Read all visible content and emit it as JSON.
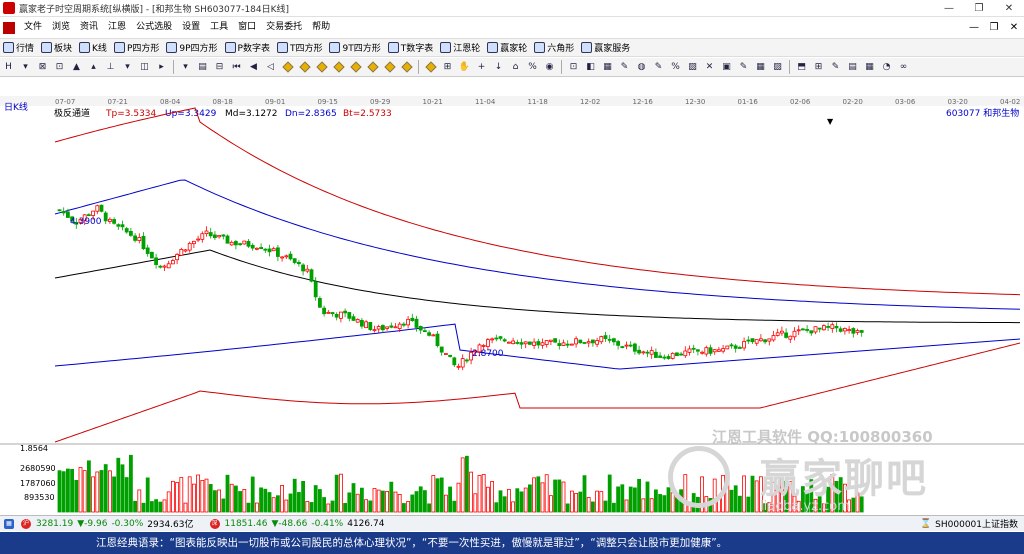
{
  "window": {
    "title": "赢家老子时空周期系统[纵横版] - [和邦生物  SH603077-184日K线]",
    "minimize": "—",
    "restore": "❐",
    "close": "✕"
  },
  "menu": {
    "items": [
      "文件",
      "浏览",
      "资讯",
      "江恩",
      "公式选股",
      "设置",
      "工具",
      "窗口",
      "交易委托",
      "帮助"
    ],
    "right_controls": [
      "—",
      "❐",
      "✕"
    ]
  },
  "toolbar1": {
    "items": [
      {
        "icon": "grid-icon",
        "label": "行情"
      },
      {
        "icon": "blocks-icon",
        "label": "板块"
      },
      {
        "icon": "candle-icon",
        "label": "K线"
      },
      {
        "icon": "p-square-icon",
        "label": "P四方形"
      },
      {
        "icon": "9p-square-icon",
        "label": "9P四方形"
      },
      {
        "icon": "p-table-icon",
        "label": "P数字表"
      },
      {
        "icon": "t-square-icon",
        "label": "T四方形"
      },
      {
        "icon": "9t-square-icon",
        "label": "9T四方形"
      },
      {
        "icon": "t-table-icon",
        "label": "T数字表"
      },
      {
        "icon": "gann-wheel-icon",
        "label": "江恩轮"
      },
      {
        "icon": "winner-wheel-icon",
        "label": "赢家轮"
      },
      {
        "icon": "hexagon-icon",
        "label": "六角形"
      },
      {
        "icon": "dollar-icon",
        "label": "赢家服务"
      }
    ]
  },
  "toolbar2": {
    "glyphs": [
      "H",
      "▾",
      "⊠",
      "⊡",
      "▲",
      "▴",
      "⊥",
      "▾",
      "◫",
      "▸",
      "▾",
      "▤",
      "⊟",
      "⏮",
      "◀",
      "◁",
      "◆",
      "◆",
      "◆",
      "◆",
      "◆",
      "◆",
      "◆",
      "◆",
      "◆",
      "⊞",
      "✋",
      "+",
      "↓",
      "⌂",
      "%",
      "◉",
      "⊡",
      "◧",
      "▦",
      "✎",
      "◍",
      "✎",
      "%",
      "▨",
      "✕",
      "▣",
      "✎",
      "▦",
      "▨",
      "⬒",
      "⊞",
      "✎",
      "▤",
      "▦",
      "◔",
      "∞"
    ]
  },
  "chart": {
    "period_label": "日K线",
    "indicator_name": "极反通道",
    "tp": "Tp=3.5334",
    "up": "Up=3.3429",
    "md": "Md=3.1272",
    "dn": "Dn=2.8365",
    "bt": "Bt=2.5733",
    "stock_label": "603077  和邦生物",
    "high_label": "4.3900",
    "low_label": "2.8700",
    "lower_price_label": "1.8564",
    "volume_ticks": [
      "2680590",
      "1787060",
      "893530"
    ],
    "date_ticks": [
      "07-07",
      "07-21",
      "08-04",
      "08-18",
      "09-01",
      "09-15",
      "09-29",
      "10-21",
      "11-04",
      "11-18",
      "12-02",
      "12-16",
      "12-30",
      "01-16",
      "02-06",
      "02-20",
      "03-06",
      "03-20",
      "04-02"
    ],
    "colors": {
      "up": "#ff0000",
      "down": "#00a000",
      "top": "#cc0000",
      "mid": "#0000cc",
      "md": "#000000"
    }
  },
  "watermark": {
    "line1": "江恩工具软件  QQ:100800360",
    "line2": "赢家聊吧",
    "line3": "liaoba.yz.com"
  },
  "status": {
    "sh_value": "3281.19",
    "sh_change": "▼-9.96",
    "sh_pct": "-0.30%",
    "sh_amount": "2934.63亿",
    "sz_value": "11851.46",
    "sz_change": "▼-48.66",
    "sz_pct": "-0.41%",
    "sz_amount": "4126.74",
    "right_label": "SH000001上证指数"
  },
  "ticker": {
    "text": "江恩经典语录：“图表能反映出一切股市或公司股民的总体心理状况”，“不要一次性买进，傲慢就是罪过”，“调整只会让股市更加健康”。"
  }
}
